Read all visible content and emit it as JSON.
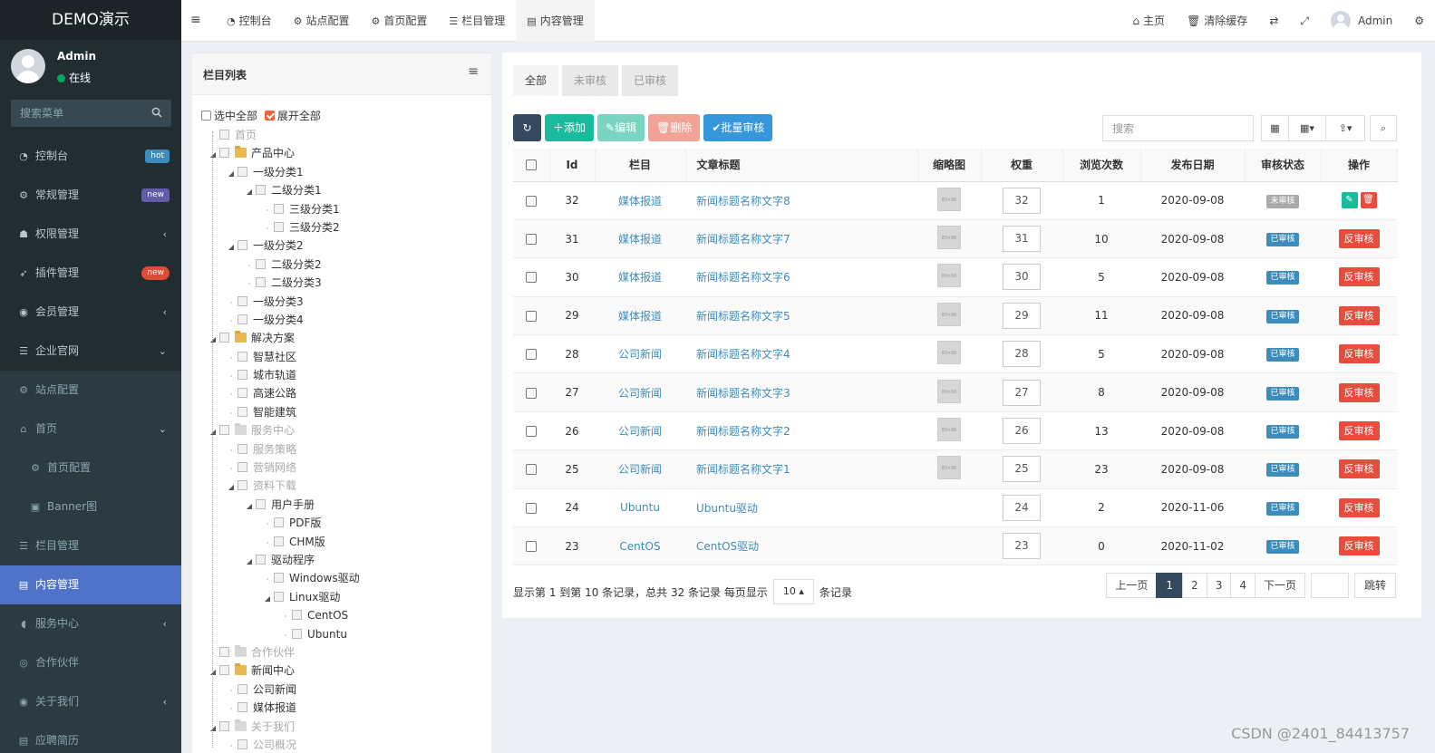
{
  "sidebar": {
    "logo": "DEMO演示",
    "user_name": "Admin",
    "user_status": "在线",
    "search_placeholder": "搜索菜单",
    "items": [
      {
        "label": "控制台",
        "badge": "hot"
      },
      {
        "label": "常规管理",
        "badge": "new"
      },
      {
        "label": "权限管理"
      },
      {
        "label": "插件管理",
        "badge": "new"
      },
      {
        "label": "会员管理"
      },
      {
        "label": "企业官网"
      },
      {
        "label": "站点配置"
      },
      {
        "label": "首页"
      },
      {
        "label": "首页配置"
      },
      {
        "label": "Banner图"
      },
      {
        "label": "栏目管理"
      },
      {
        "label": "内容管理"
      },
      {
        "label": "服务中心"
      },
      {
        "label": "合作伙伴"
      },
      {
        "label": "关于我们"
      },
      {
        "label": "应聘简历"
      }
    ]
  },
  "header": {
    "nav": [
      "控制台",
      "站点配置",
      "首页配置",
      "栏目管理",
      "内容管理"
    ],
    "home": "主页",
    "clear_cache": "清除缓存",
    "user": "Admin"
  },
  "tree": {
    "title": "栏目列表",
    "select_all": "选中全部",
    "expand_all": "展开全部",
    "nodes": [
      "首页",
      "产品中心",
      "一级分类1",
      "二级分类1",
      "三级分类1",
      "三级分类2",
      "一级分类2",
      "二级分类2",
      "二级分类3",
      "一级分类3",
      "一级分类4",
      "解决方案",
      "智慧社区",
      "城市轨道",
      "高速公路",
      "智能建筑",
      "服务中心",
      "服务策略",
      "营销网络",
      "资料下载",
      "用户手册",
      "PDF版",
      "CHM版",
      "驱动程序",
      "Windows驱动",
      "Linux驱动",
      "CentOS",
      "Ubuntu",
      "合作伙伴",
      "新闻中心",
      "公司新闻",
      "媒体报道",
      "关于我们",
      "公司概况"
    ]
  },
  "main": {
    "tabs": [
      "全部",
      "未审核",
      "已审核"
    ],
    "toolbar": {
      "add": "添加",
      "edit": "编辑",
      "delete": "删除",
      "batch_audit": "批量审核"
    },
    "search_placeholder": "搜索",
    "columns": [
      "Id",
      "栏目",
      "文章标题",
      "缩略图",
      "权重",
      "浏览次数",
      "发布日期",
      "审核状态",
      "操作"
    ],
    "thumb_label": "80×80",
    "rows": [
      {
        "id": "32",
        "column": "媒体报道",
        "title": "新闻标题名称文字8",
        "thumb": true,
        "weight": "32",
        "views": "1",
        "date": "2020-09-08",
        "status": "未审核",
        "action": ""
      },
      {
        "id": "31",
        "column": "媒体报道",
        "title": "新闻标题名称文字7",
        "thumb": true,
        "weight": "31",
        "views": "10",
        "date": "2020-09-08",
        "status": "已审核",
        "action": "反审核"
      },
      {
        "id": "30",
        "column": "媒体报道",
        "title": "新闻标题名称文字6",
        "thumb": true,
        "weight": "30",
        "views": "5",
        "date": "2020-09-08",
        "status": "已审核",
        "action": "反审核"
      },
      {
        "id": "29",
        "column": "媒体报道",
        "title": "新闻标题名称文字5",
        "thumb": true,
        "weight": "29",
        "views": "11",
        "date": "2020-09-08",
        "status": "已审核",
        "action": "反审核"
      },
      {
        "id": "28",
        "column": "公司新闻",
        "title": "新闻标题名称文字4",
        "thumb": true,
        "weight": "28",
        "views": "5",
        "date": "2020-09-08",
        "status": "已审核",
        "action": "反审核"
      },
      {
        "id": "27",
        "column": "公司新闻",
        "title": "新闻标题名称文字3",
        "thumb": true,
        "weight": "27",
        "views": "8",
        "date": "2020-09-08",
        "status": "已审核",
        "action": "反审核"
      },
      {
        "id": "26",
        "column": "公司新闻",
        "title": "新闻标题名称文字2",
        "thumb": true,
        "weight": "26",
        "views": "13",
        "date": "2020-09-08",
        "status": "已审核",
        "action": "反审核"
      },
      {
        "id": "25",
        "column": "公司新闻",
        "title": "新闻标题名称文字1",
        "thumb": true,
        "weight": "25",
        "views": "23",
        "date": "2020-09-08",
        "status": "已审核",
        "action": "反审核"
      },
      {
        "id": "24",
        "column": "Ubuntu",
        "title": "Ubuntu驱动",
        "thumb": false,
        "weight": "24",
        "views": "2",
        "date": "2020-11-06",
        "status": "已审核",
        "action": "反审核"
      },
      {
        "id": "23",
        "column": "CentOS",
        "title": "CentOS驱动",
        "thumb": false,
        "weight": "23",
        "views": "0",
        "date": "2020-11-02",
        "status": "已审核",
        "action": "反审核"
      }
    ],
    "footer": {
      "info": "显示第 1 到第 10 条记录，总共 32 条记录 每页显示",
      "page_size": "10",
      "suffix": "条记录"
    },
    "pager": {
      "prev": "上一页",
      "pages": [
        "1",
        "2",
        "3",
        "4"
      ],
      "next": "下一页",
      "jump": "跳转"
    }
  },
  "watermark": "CSDN @2401_84413757",
  "colors": {
    "sidebar": "#222d32",
    "active_menu": "#4f73c8",
    "link": "#3c8dbc",
    "danger": "#e74c3c",
    "success": "#18bc9c"
  }
}
